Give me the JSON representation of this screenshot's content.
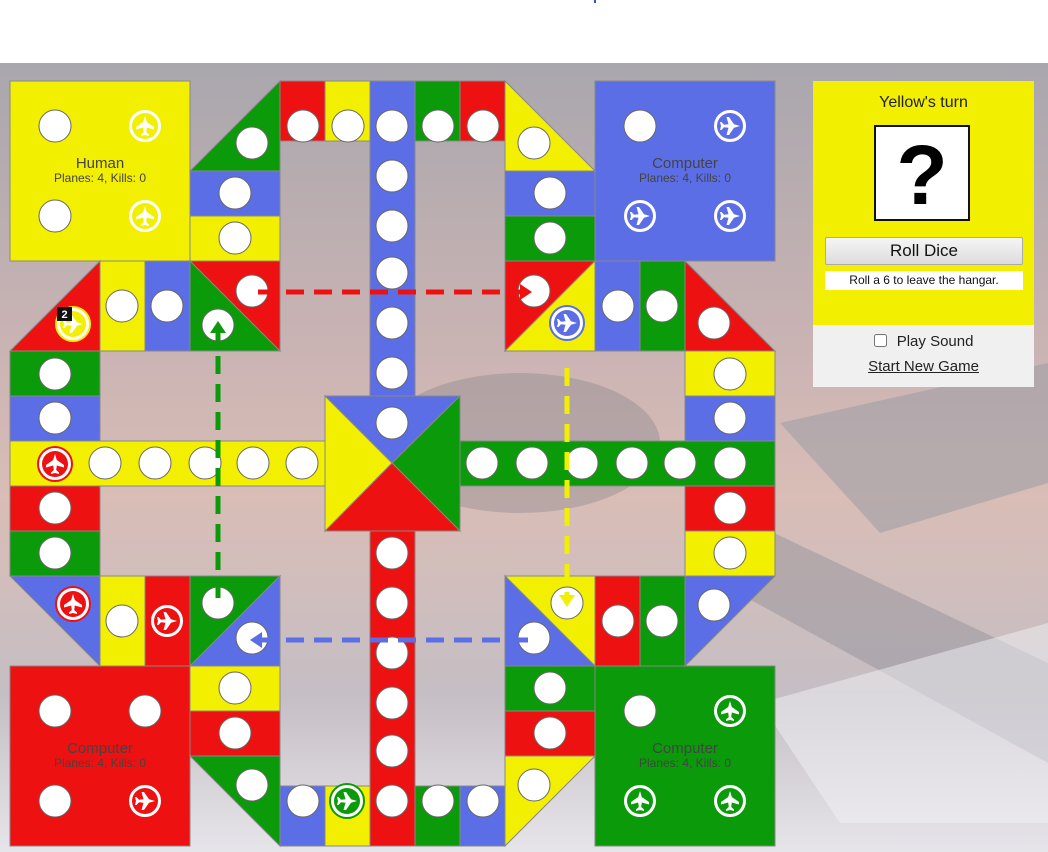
{
  "colors": {
    "yellow": "#f2ef00",
    "blue": "#5b6ee6",
    "green": "#0a9a0a",
    "red": "#ee1111",
    "panel_yellow": "#f2ef00",
    "panel_gray": "#f0f0f0"
  },
  "hangars": {
    "yellow": {
      "name": "Human",
      "stats": "Planes: 4, Kills: 0"
    },
    "blue": {
      "name": "Computer",
      "stats": "Planes: 4, Kills: 0"
    },
    "red": {
      "name": "Computer",
      "stats": "Planes: 4, Kills: 0"
    },
    "green": {
      "name": "Computer",
      "stats": "Planes: 4, Kills: 0"
    }
  },
  "planes": {
    "yellow_hangar": 2,
    "blue_hangar": 3,
    "red_hangar": 1,
    "green_hangar": 3,
    "yellow_stack_badge": "2",
    "icon": "plane-icon"
  },
  "panel": {
    "turn_title": "Yellow's turn",
    "dice_face": "?",
    "roll_button": "Roll Dice",
    "hint": "Roll a 6 to leave the hangar.",
    "play_sound_label": "Play Sound",
    "play_sound_checked": false,
    "new_game_label": "Start New Game"
  }
}
